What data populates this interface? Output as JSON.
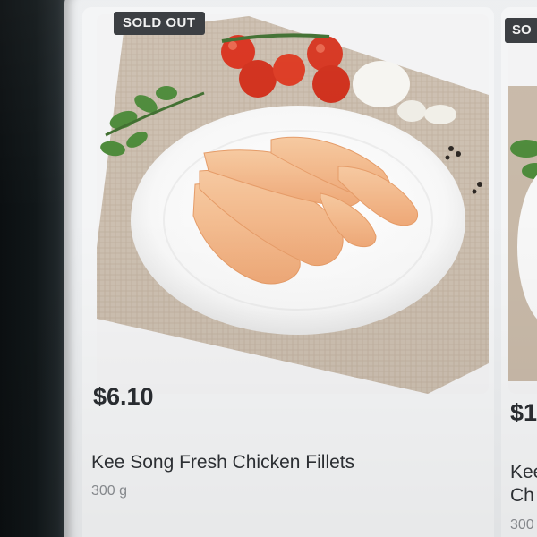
{
  "products": [
    {
      "badge": "SOLD OUT",
      "price": "$6.10",
      "name": "Kee Song Fresh Chicken Fillets",
      "weight": "300 g",
      "image_icon": "chicken-fillets-plate-photo"
    },
    {
      "badge": "SO",
      "price": "$1",
      "name_line1": "Kee",
      "name_line2": "Ch",
      "weight": "300"
    }
  ],
  "colors": {
    "badge_bg": "#3c3f43",
    "badge_text": "#f2f2f2",
    "price_text": "#2a2d31",
    "name_text": "#2e3135",
    "weight_text": "#8b8e92",
    "card_bg": "#f4f5f6"
  }
}
